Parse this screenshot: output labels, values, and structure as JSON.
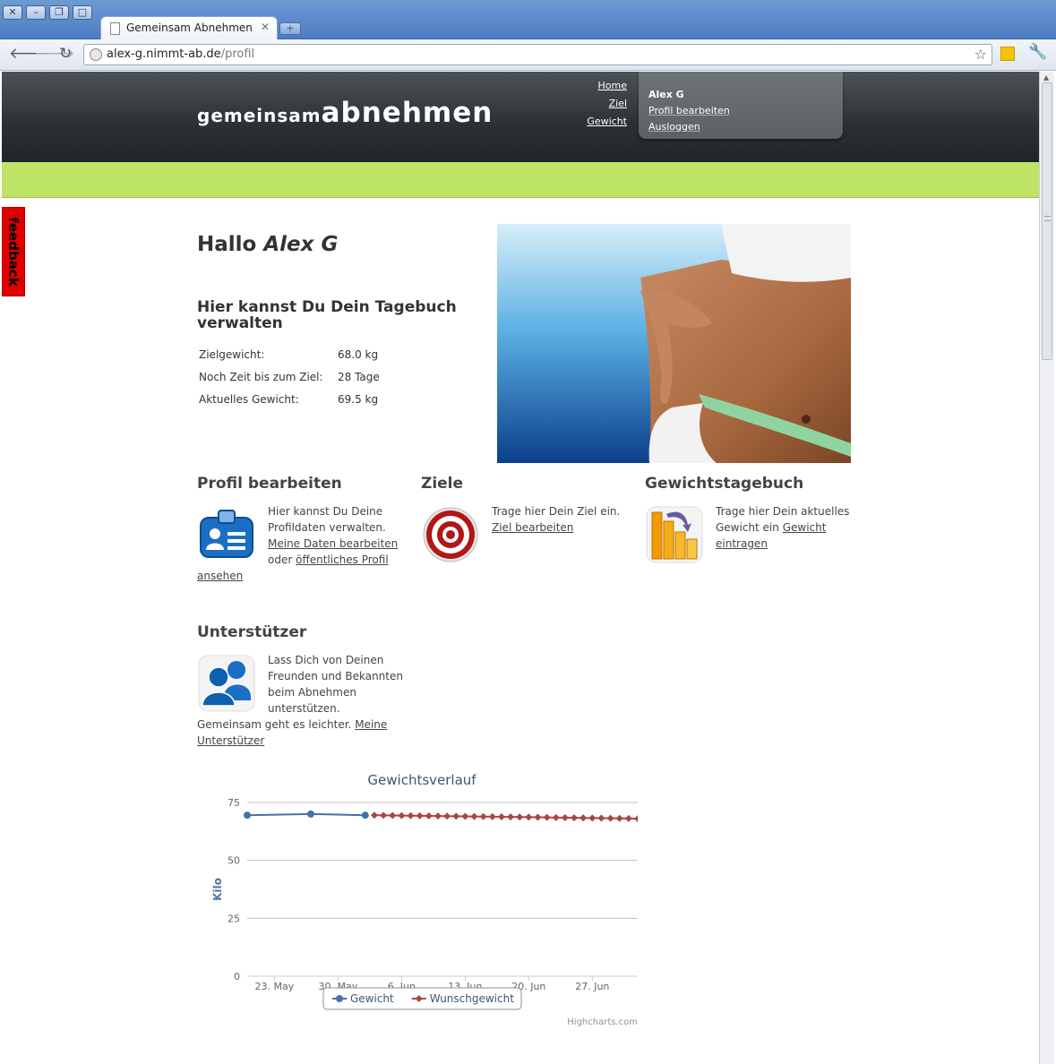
{
  "browser": {
    "tab_title": "Gemeinsam Abnehmen",
    "url_host": "alex-g.nimmt-ab.de",
    "url_path": "/profil",
    "window_controls": [
      "close-icon",
      "minimize-icon",
      "restore-icon",
      "maximize-icon"
    ]
  },
  "site": {
    "logo_light": "gemeinsam",
    "logo_bold": "abnehmen",
    "nav": [
      "Home",
      "Ziel",
      "Gewicht"
    ],
    "user": {
      "name": "Alex G",
      "links": [
        "Profil bearbeiten",
        "Ausloggen"
      ]
    },
    "feedback_label": "feedback"
  },
  "main": {
    "greeting_prefix": "Hallo",
    "greeting_name": "Alex G",
    "diary_heading": "Hier kannst Du Dein Tagebuch verwalten",
    "stats": [
      {
        "label": "Zielgewicht:",
        "value": "68.0 kg"
      },
      {
        "label": "Noch Zeit bis zum Ziel:",
        "value": "28 Tage"
      },
      {
        "label": "Aktuelles Gewicht:",
        "value": "69.5 kg"
      }
    ],
    "sections": {
      "profile": {
        "title": "Profil bearbeiten",
        "text": "Hier kannst Du Deine Profildaten verwalten.",
        "link1": "Meine Daten bearbeiten",
        "mid": "oder",
        "link2": "öffentliches Profil ansehen",
        "icon": "id-card-icon"
      },
      "goals": {
        "title": "Ziele",
        "text": "Trage hier Dein Ziel ein.",
        "link": "Ziel bearbeiten",
        "icon": "target-icon"
      },
      "weight": {
        "title": "Gewichtstagebuch",
        "text": "Trage hier Dein aktuelles Gewicht ein",
        "link": "Gewicht eintragen",
        "icon": "bar-chart-icon"
      },
      "supporters": {
        "title": "Unterstützer",
        "text": "Lass Dich von Deinen Freunden und Bekannten beim Abnehmen unterstützen. Gemeinsam geht es leichter.",
        "link": "Meine Unterstützer",
        "icon": "users-icon"
      }
    }
  },
  "chart_data": {
    "type": "line",
    "title": "Gewichtsverlauf",
    "ylabel": "Kilo",
    "xlabel": "",
    "ylim": [
      0,
      75
    ],
    "yticks": [
      0,
      25,
      50,
      75
    ],
    "xlim": [
      "2011-05-20",
      "2011-07-02"
    ],
    "xticks": [
      "23. May",
      "30. May",
      "6. Jun",
      "13. Jun",
      "20. Jun",
      "27. Jun"
    ],
    "xtick_dates": [
      "2011-05-23",
      "2011-05-30",
      "2011-06-06",
      "2011-06-13",
      "2011-06-20",
      "2011-06-27"
    ],
    "grid": true,
    "legend_position": "bottom-center",
    "series": [
      {
        "name": "Gewicht",
        "color": "#4572a7",
        "marker": "circle",
        "x": [
          "2011-05-20",
          "2011-05-27",
          "2011-06-02"
        ],
        "y": [
          69.5,
          70.0,
          69.5
        ]
      },
      {
        "name": "Wunschgewicht",
        "color": "#aa4643",
        "marker": "diamond",
        "x": [
          "2011-06-03",
          "2011-06-04",
          "2011-06-05",
          "2011-06-06",
          "2011-06-07",
          "2011-06-08",
          "2011-06-09",
          "2011-06-10",
          "2011-06-11",
          "2011-06-12",
          "2011-06-13",
          "2011-06-14",
          "2011-06-15",
          "2011-06-16",
          "2011-06-17",
          "2011-06-18",
          "2011-06-19",
          "2011-06-20",
          "2011-06-21",
          "2011-06-22",
          "2011-06-23",
          "2011-06-24",
          "2011-06-25",
          "2011-06-26",
          "2011-06-27",
          "2011-06-28",
          "2011-06-29",
          "2011-06-30",
          "2011-07-01",
          "2011-07-02"
        ],
        "y": [
          69.5,
          69.45,
          69.4,
          69.35,
          69.3,
          69.25,
          69.2,
          69.15,
          69.1,
          69.05,
          69.0,
          68.95,
          68.9,
          68.85,
          68.8,
          68.75,
          68.7,
          68.65,
          68.6,
          68.55,
          68.5,
          68.45,
          68.4,
          68.35,
          68.3,
          68.25,
          68.2,
          68.15,
          68.1,
          68.0
        ]
      }
    ],
    "credits": "Highcharts.com"
  },
  "colors": {
    "header_dark": "#2b3035",
    "accent_green": "#bde465",
    "feedback_red": "#e00000",
    "chart_title": "#3e576f"
  }
}
